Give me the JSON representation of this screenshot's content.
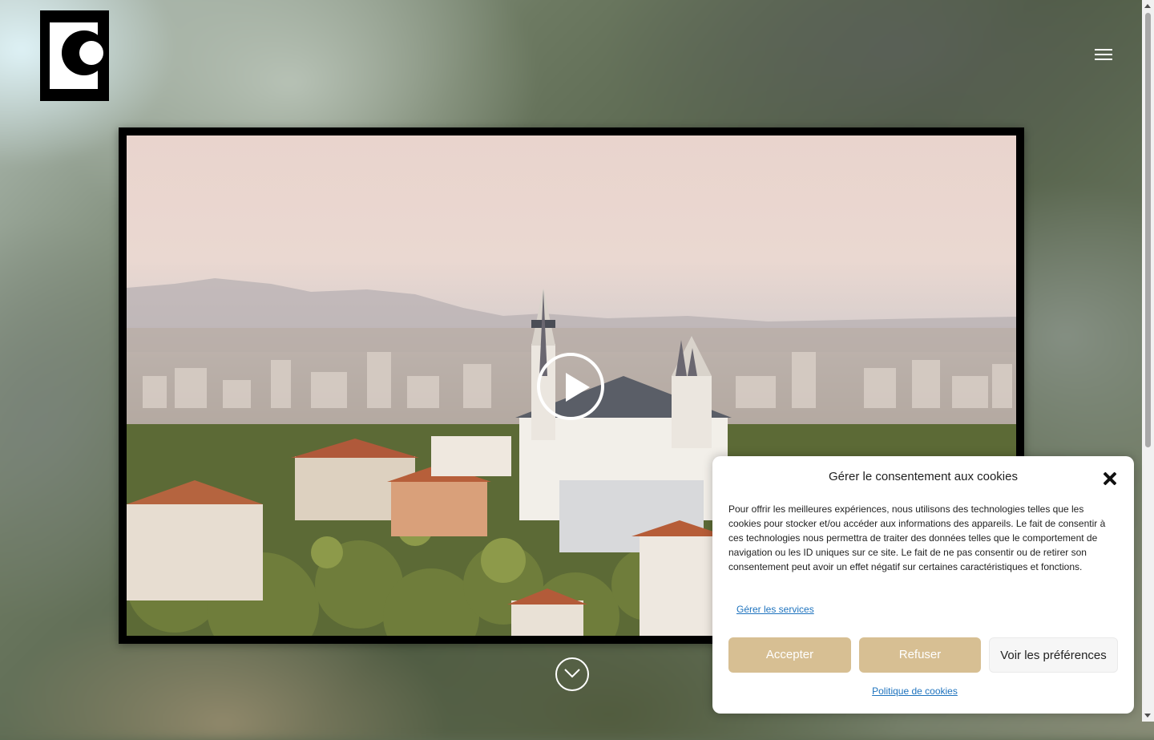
{
  "header": {
    "logo_icon": "brand-logo-c",
    "menu_icon": "hamburger-menu-icon"
  },
  "video": {
    "play_icon": "play-icon"
  },
  "scroll_down": {
    "icon": "chevron-down-circle-icon"
  },
  "cookie_banner": {
    "title": "Gérer le consentement aux cookies",
    "close_icon": "close-icon",
    "body": "Pour offrir les meilleures expériences, nous utilisons des technologies telles que les cookies pour stocker et/ou accéder aux informations des appareils. Le fait de consentir à ces technologies nous permettra de traiter des données telles que le comportement de navigation ou les ID uniques sur ce site. Le fait de ne pas consentir ou de retirer son consentement peut avoir un effet négatif sur certaines caractéristiques et fonctions.",
    "manage_services": "Gérer les services",
    "accept_label": "Accepter",
    "refuse_label": "Refuser",
    "preferences_label": "Voir les préférences",
    "policy_link": "Politique de cookies",
    "accent_color": "#d7bf93"
  }
}
